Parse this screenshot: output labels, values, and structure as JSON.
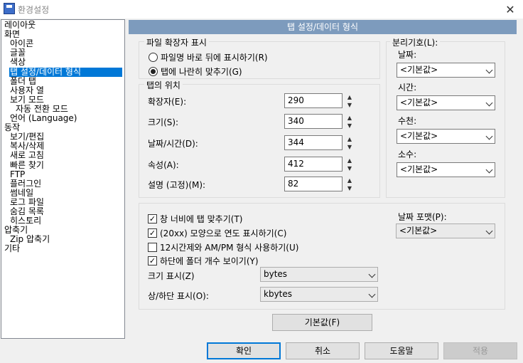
{
  "window": {
    "title": "환경설정",
    "close": "✕"
  },
  "tree": [
    {
      "label": "레이아웃",
      "indent": 0
    },
    {
      "label": "화면",
      "indent": 0
    },
    {
      "label": "아이콘",
      "indent": 1
    },
    {
      "label": "글꼴",
      "indent": 1
    },
    {
      "label": "색상",
      "indent": 1
    },
    {
      "label": "탭 설정/데이터 형식",
      "indent": 1,
      "selected": true
    },
    {
      "label": "폴더 탭",
      "indent": 1
    },
    {
      "label": "사용자 열",
      "indent": 1
    },
    {
      "label": "보기 모드",
      "indent": 1
    },
    {
      "label": "자동 전환 모드",
      "indent": 2
    },
    {
      "label": "언어 (Language)",
      "indent": 1
    },
    {
      "label": "동작",
      "indent": 0
    },
    {
      "label": "보기/편집",
      "indent": 1
    },
    {
      "label": "복사/삭제",
      "indent": 1
    },
    {
      "label": "새로 고침",
      "indent": 1
    },
    {
      "label": "빠른 찾기",
      "indent": 1
    },
    {
      "label": "FTP",
      "indent": 1
    },
    {
      "label": "플러그인",
      "indent": 1
    },
    {
      "label": "썸네일",
      "indent": 1
    },
    {
      "label": "로그 파일",
      "indent": 1
    },
    {
      "label": "숨김 목록",
      "indent": 1
    },
    {
      "label": "히스토리",
      "indent": 1
    },
    {
      "label": "압축기",
      "indent": 0
    },
    {
      "label": "Zip 압축기",
      "indent": 1
    },
    {
      "label": "기타",
      "indent": 0
    }
  ],
  "header": "탭 설정/데이터 형식",
  "ext_group": {
    "title": "파일 확장자 표시",
    "opt1": "파일명 바로 뒤에 표시하기(R)",
    "opt2": "탭에 나란히 맞추기(G)",
    "selected": "opt2"
  },
  "tabpos": {
    "title": "탭의 위치",
    "fields": [
      {
        "label": "확장자(E):",
        "value": "290"
      },
      {
        "label": "크기(S):",
        "value": "340"
      },
      {
        "label": "날짜/시간(D):",
        "value": "344"
      },
      {
        "label": "속성(A):",
        "value": "412"
      },
      {
        "label": "설명 (고정)(M):",
        "value": "82"
      }
    ]
  },
  "separator": {
    "title": "분리기호(L):",
    "fields": [
      {
        "label": "날짜:",
        "value": "<기본값>"
      },
      {
        "label": "시간:",
        "value": "<기본값>"
      },
      {
        "label": "수천:",
        "value": "<기본값>"
      },
      {
        "label": "소수:",
        "value": "<기본값>"
      }
    ]
  },
  "options": {
    "checks": [
      {
        "label": "창 너비에 탭 맞추기(T)",
        "checked": true
      },
      {
        "label": "(20xx) 모양으로 연도 표시하기(C)",
        "checked": true
      },
      {
        "label": "12시간제와 AM/PM 형식 사용하기(U)",
        "checked": false
      },
      {
        "label": "하단에 폴더 개수 보이기(Y)",
        "checked": true
      }
    ],
    "size_label": "크기 표시(Z)",
    "size_value": "bytes",
    "status_label": "상/하단 표시(O):",
    "status_value": "kbytes",
    "date_format_label": "날짜 포맷(P):",
    "date_format_value": "<기본값>"
  },
  "buttons": {
    "defaults": "기본값(F)",
    "ok": "확인",
    "cancel": "취소",
    "help": "도움말",
    "apply": "적용"
  }
}
